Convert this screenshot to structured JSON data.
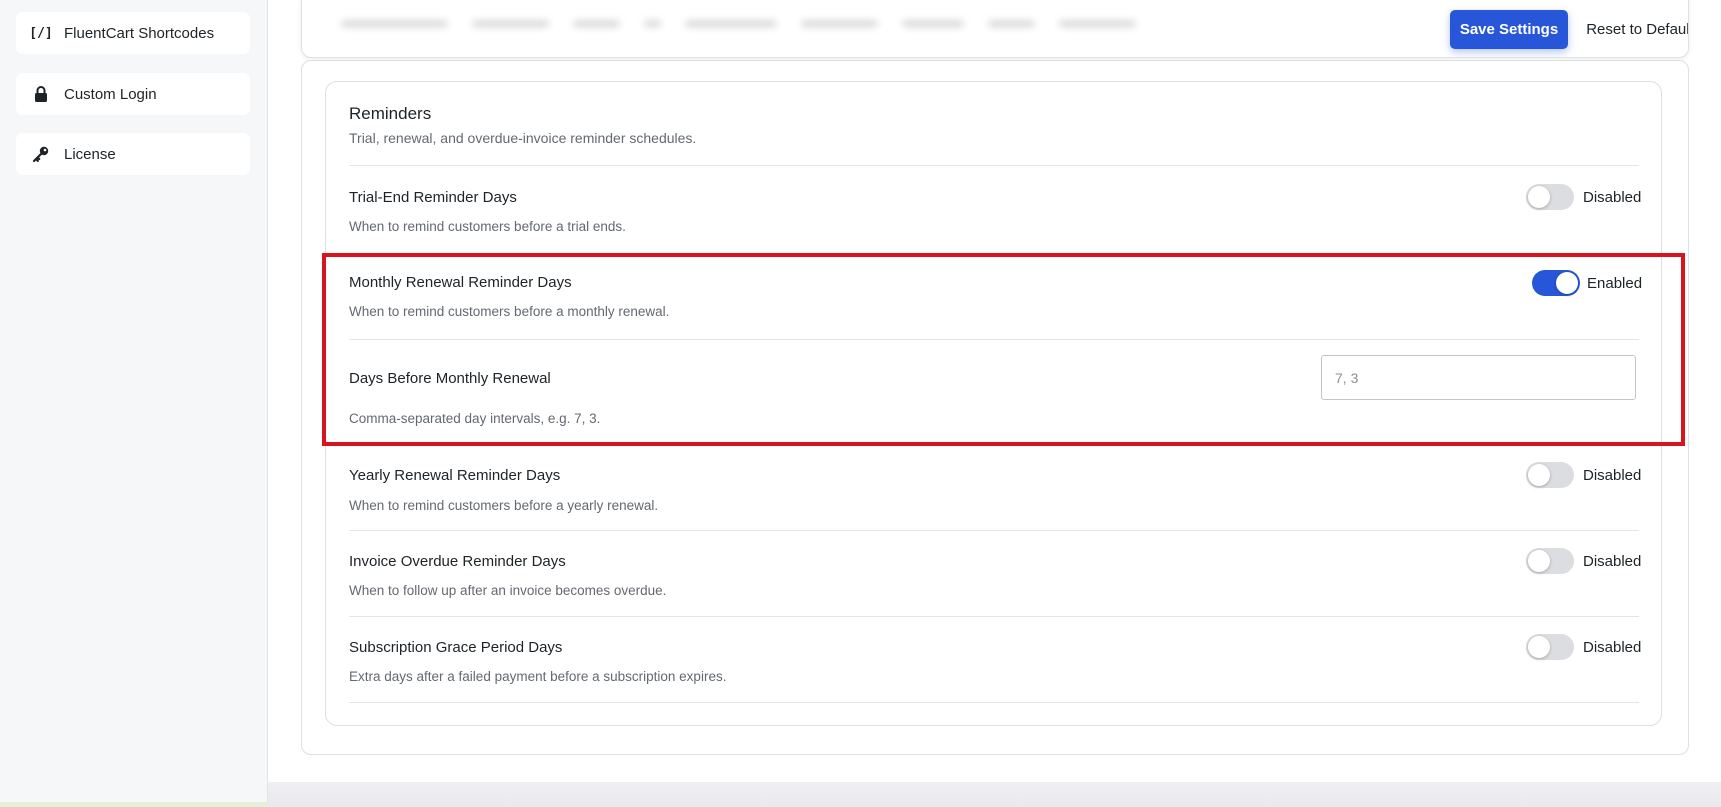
{
  "sidebar": {
    "items": [
      {
        "label": "FluentCart Shortcodes",
        "icon": "code-brackets-icon"
      },
      {
        "label": "Custom Login",
        "icon": "lock-icon"
      },
      {
        "label": "License",
        "icon": "key-icon"
      }
    ]
  },
  "toolbar": {
    "save_label": "Save Settings",
    "reset_label": "Reset to Default"
  },
  "reminders": {
    "title": "Reminders",
    "subtitle": "Trial, renewal, and overdue-invoice reminder schedules.",
    "rows": [
      {
        "label": "Trial-End Reminder Days",
        "description": "When to remind customers before a trial ends.",
        "state": "Disabled",
        "enabled": false
      },
      {
        "label": "Monthly Renewal Reminder Days",
        "description": "When to remind customers before a monthly renewal.",
        "state": "Enabled",
        "enabled": true
      },
      {
        "label": "Yearly Renewal Reminder Days",
        "description": "When to remind customers before a yearly renewal.",
        "state": "Disabled",
        "enabled": false
      },
      {
        "label": "Invoice Overdue Reminder Days",
        "description": "When to follow up after an invoice becomes overdue.",
        "state": "Disabled",
        "enabled": false
      },
      {
        "label": "Subscription Grace Period Days",
        "description": "Extra days after a failed payment before a subscription expires.",
        "state": "Disabled",
        "enabled": false
      }
    ],
    "days_field": {
      "label": "Days Before Monthly Renewal",
      "placeholder": "7, 3",
      "help": "Comma-separated day intervals, e.g. 7, 3."
    }
  },
  "colors": {
    "accent": "#2856d9",
    "highlight": "#d9141e"
  }
}
